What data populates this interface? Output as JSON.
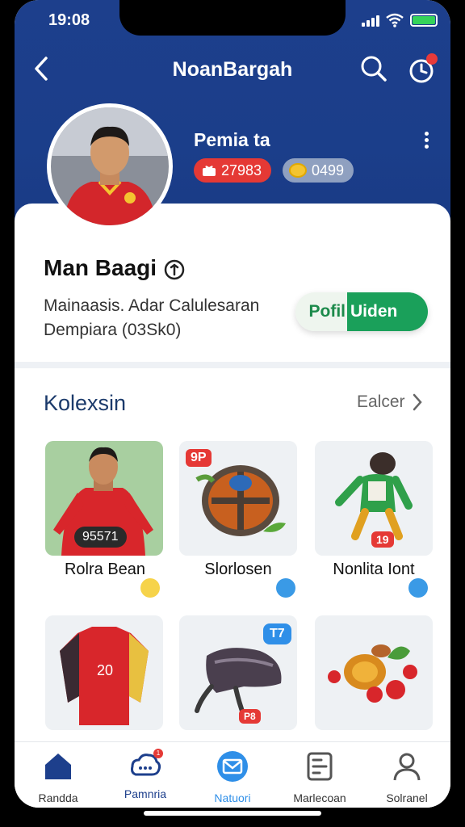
{
  "status": {
    "time": "19:08"
  },
  "nav": {
    "title": "NoanBargah"
  },
  "profile": {
    "name": "Pemia ta",
    "points": "27983",
    "coins": "0499"
  },
  "user": {
    "title": "Man Baagi",
    "desc_line1": "Mainaasis. Adar Calulesaran",
    "desc_line2": "Dempiara (03Sk0)",
    "button_left": "Pofil",
    "button_right": "Uiden"
  },
  "collection": {
    "title": "Kolexsin",
    "see_all": "Ealcer",
    "items": [
      {
        "label": "Rolra Bean",
        "tag": "95571"
      },
      {
        "label": "Slorlosen",
        "tag": "9P"
      },
      {
        "label": "Nonlita Iont",
        "tag": "19"
      },
      {
        "label": "",
        "tag": ""
      },
      {
        "label": "",
        "tag": "T7"
      },
      {
        "label": "",
        "tag": ""
      }
    ],
    "extra_tag": "P8"
  },
  "bottom_nav": [
    {
      "label": "Randda",
      "icon": "home-icon"
    },
    {
      "label": "Pamnria",
      "icon": "cloud-notification-icon",
      "badge": "1"
    },
    {
      "label": "Natuori",
      "icon": "mail-icon"
    },
    {
      "label": "Marlecoan",
      "icon": "document-icon"
    },
    {
      "label": "Solranel",
      "icon": "profile-icon"
    }
  ],
  "colors": {
    "header": "#1b3e8a",
    "accent_green": "#1aa05a",
    "badge_red": "#e53935",
    "title_blue": "#1b3a6b"
  }
}
